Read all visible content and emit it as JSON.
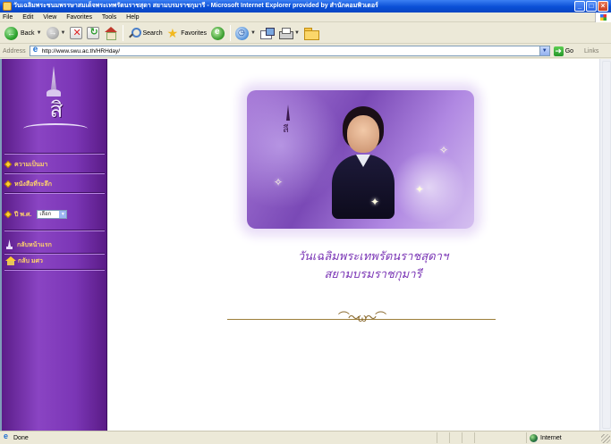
{
  "window": {
    "title": "วันเฉลิมพระชนมพรรษาสมเด็จพระเทพรัตนราชสุดา สยามบรมราชกุมารี - Microsoft Internet Explorer provided by สำนักคอมพิวเตอร์",
    "controls": [
      "minimize",
      "maximize",
      "close"
    ]
  },
  "menubar": {
    "items": [
      "File",
      "Edit",
      "View",
      "Favorites",
      "Tools",
      "Help"
    ]
  },
  "toolbar": {
    "back_label": "Back",
    "search_label": "Search",
    "favorites_label": "Favorites"
  },
  "addressbar": {
    "label": "Address",
    "url": "http://www.swu.ac.th/HRHday/",
    "go_label": "Go",
    "links_label": "Links"
  },
  "sidebar": {
    "items": [
      {
        "label": "ความเป็นมา",
        "icon": "diamond-bullet-icon"
      },
      {
        "label": "หนังสือที่ระลึก",
        "icon": "diamond-bullet-icon"
      },
      {
        "label": "ปี พ.ศ.",
        "icon": "diamond-bullet-icon"
      },
      {
        "label": "กลับหน้าแรก",
        "icon": "emblem-small-icon"
      },
      {
        "label": "กลับ มศว",
        "icon": "roof-icon"
      }
    ],
    "year_select": {
      "value": "เลือก"
    }
  },
  "main": {
    "caption_line1": "วันเฉลิมพระเทพรัตนราชสุดาฯ",
    "caption_line2": "สยามบรมราชกุมารี"
  },
  "statusbar": {
    "status": "Done",
    "zone": "Internet"
  },
  "colors": {
    "sidebar_purple": "#7b36b6",
    "link_gold": "#ffd36a",
    "caption_purple": "#7a35b5",
    "xp_blue": "#0a4fd6"
  }
}
